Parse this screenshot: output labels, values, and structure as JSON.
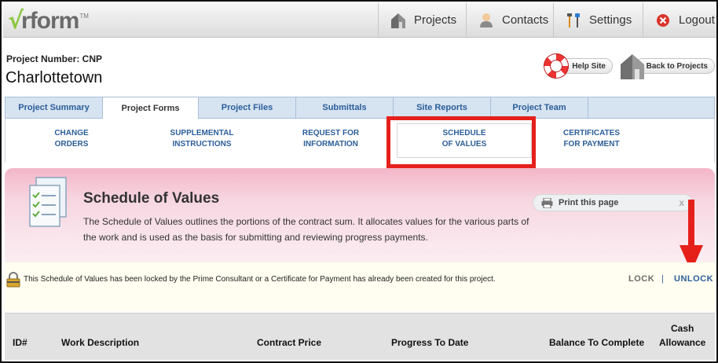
{
  "logo": {
    "check": "√",
    "text": "rform",
    "tm": "TM"
  },
  "nav": {
    "projects": "Projects",
    "contacts": "Contacts",
    "settings": "Settings",
    "logout": "Logout"
  },
  "project": {
    "number_label": "Project Number: CNP",
    "name": "Charlottetown"
  },
  "header_buttons": {
    "help": "Help Site",
    "back": "Back to Projects"
  },
  "tabs": [
    {
      "label": "Project Summary"
    },
    {
      "label": "Project Forms"
    },
    {
      "label": "Project Files"
    },
    {
      "label": "Submittals"
    },
    {
      "label": "Site Reports"
    },
    {
      "label": "Project Team"
    }
  ],
  "subtabs": [
    {
      "line1": "CHANGE",
      "line2": "ORDERS"
    },
    {
      "line1": "SUPPLEMENTAL",
      "line2": "INSTRUCTIONS"
    },
    {
      "line1": "REQUEST FOR",
      "line2": "INFORMATION"
    },
    {
      "line1": "SCHEDULE",
      "line2": "OF VALUES"
    },
    {
      "line1": "CERTIFICATES",
      "line2": "FOR PAYMENT"
    }
  ],
  "hero": {
    "title": "Schedule of Values",
    "description": "The Schedule of Values outlines the portions of the contract sum. It allocates values for the various parts of the work and is used as the basis for submitting and reviewing progress payments.",
    "print_label": "Print this page",
    "close": "x"
  },
  "notice": {
    "text": "This Schedule of Values has been locked by the Prime Consultant or a Certificate for Payment has already been created for this project.",
    "lock": "LOCK",
    "separator": "|",
    "unlock": "UNLOCK"
  },
  "table": {
    "columns": [
      "ID#",
      "Work Description",
      "Contract Price",
      "Progress To Date",
      "Balance To Complete",
      "Cash",
      "Allowance"
    ]
  },
  "colors": {
    "accent_blue": "#2b5e99",
    "highlight_red": "#e5201b",
    "logo_green": "#8cc63f",
    "hero_pink": "#f3b6c8"
  }
}
